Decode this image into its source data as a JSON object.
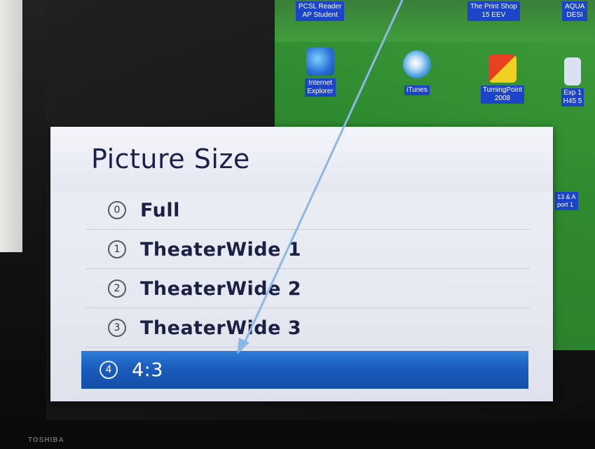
{
  "desktop": {
    "top_captions": [
      "",
      "PCSL Reader\nAP Student",
      "The Print Shop\n15 EEV",
      "AQUA\nDESI"
    ],
    "icons": [
      {
        "name": "internet-explorer-icon",
        "label": "Internet\nExplorer",
        "color": "#2a6fd6"
      },
      {
        "name": "itunes-icon",
        "label": "iTunes",
        "color": "#4aa2e0"
      },
      {
        "name": "turningpoint-icon",
        "label": "TurningPoint\n2008",
        "color": "#e0a020"
      },
      {
        "name": "edge-icon",
        "label": "Exp 1\nH45 5",
        "color": "#3a6fd0"
      }
    ],
    "side_caption": "13 & A\nport 1"
  },
  "menu": {
    "title": "Picture Size",
    "items": [
      {
        "num": "0",
        "label": "Full",
        "selected": false
      },
      {
        "num": "1",
        "label": "TheaterWide 1",
        "selected": false
      },
      {
        "num": "2",
        "label": "TheaterWide 2",
        "selected": false
      },
      {
        "num": "3",
        "label": "TheaterWide 3",
        "selected": false
      },
      {
        "num": "4",
        "label": "4:3",
        "selected": true
      }
    ]
  },
  "brand": "TOSHIBA",
  "colors": {
    "selection": "#1b5cbc",
    "arrow": "#8db8e6",
    "desktop_green": "#3f9d3a"
  }
}
